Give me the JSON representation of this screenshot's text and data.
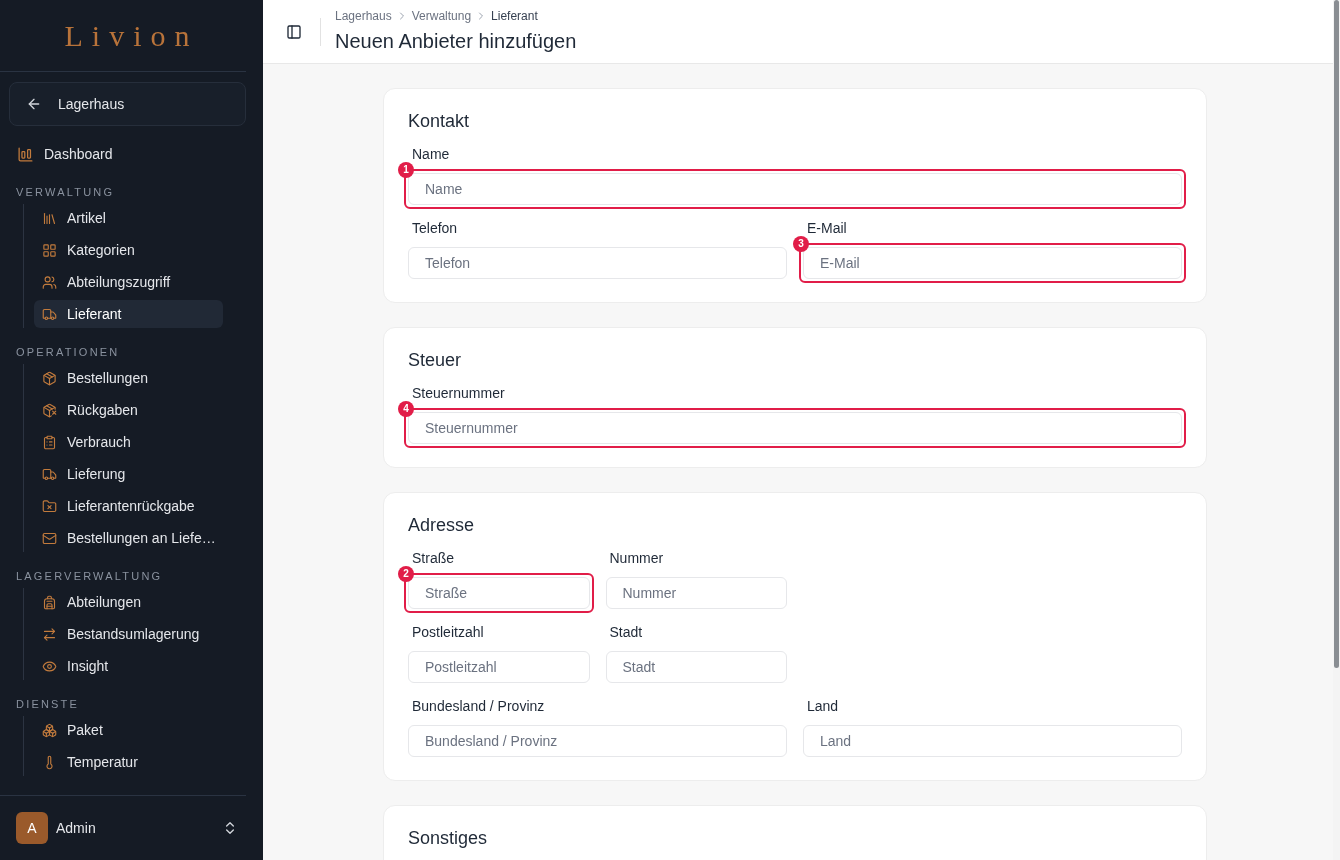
{
  "sidebar": {
    "logo": "Livion",
    "back_button": "Lagerhaus",
    "items": [
      {
        "label": "Dashboard",
        "selected": false
      }
    ],
    "sections": [
      {
        "title": "VERWALTUNG",
        "items": [
          {
            "label": "Artikel",
            "selected": false
          },
          {
            "label": "Kategorien",
            "selected": false
          },
          {
            "label": "Abteilungszugriff",
            "selected": false
          },
          {
            "label": "Lieferant",
            "selected": true
          }
        ]
      },
      {
        "title": "OPERATIONEN",
        "items": [
          {
            "label": "Bestellungen",
            "selected": false
          },
          {
            "label": "Rückgaben",
            "selected": false
          },
          {
            "label": "Verbrauch",
            "selected": false
          },
          {
            "label": "Lieferung",
            "selected": false
          },
          {
            "label": "Lieferantenrückgabe",
            "selected": false
          },
          {
            "label": "Bestellungen an Liefe…",
            "selected": false
          }
        ]
      },
      {
        "title": "LAGERVERWALTUNG",
        "items": [
          {
            "label": "Abteilungen",
            "selected": false
          },
          {
            "label": "Bestandsumlagerung",
            "selected": false
          },
          {
            "label": "Insight",
            "selected": false
          }
        ]
      },
      {
        "title": "DIENSTE",
        "items": [
          {
            "label": "Paket",
            "selected": false
          },
          {
            "label": "Temperatur",
            "selected": false
          }
        ]
      }
    ],
    "user": {
      "initial": "A",
      "name": "Admin"
    }
  },
  "header": {
    "breadcrumb": [
      {
        "label": "Lagerhaus",
        "current": false
      },
      {
        "label": "Verwaltung",
        "current": false
      },
      {
        "label": "Lieferant",
        "current": true
      }
    ],
    "title": "Neuen Anbieter hinzufügen"
  },
  "cards": [
    {
      "title": "Kontakt",
      "rows": [
        [
          {
            "label": "Name",
            "placeholder": "Name",
            "marker": "1"
          }
        ],
        [
          {
            "label": "Telefon",
            "placeholder": "Telefon"
          },
          {
            "label": "E-Mail",
            "placeholder": "E-Mail",
            "marker": "3"
          }
        ]
      ]
    },
    {
      "title": "Steuer",
      "rows": [
        [
          {
            "label": "Steuernummer",
            "placeholder": "Steuernummer",
            "marker": "4"
          }
        ]
      ]
    },
    {
      "title": "Adresse",
      "rows": [
        [
          {
            "label": "Straße",
            "placeholder": "Straße",
            "marker": "2"
          },
          {
            "label": "Nummer",
            "placeholder": "Nummer"
          }
        ],
        [
          {
            "label": "Postleitzahl",
            "placeholder": "Postleitzahl"
          },
          {
            "label": "Stadt",
            "placeholder": "Stadt"
          }
        ],
        [
          {
            "label": "Bundesland / Provinz",
            "placeholder": "Bundesland / Provinz"
          },
          {
            "label": "Land",
            "placeholder": "Land"
          }
        ]
      ]
    },
    {
      "title": "Sonstiges"
    }
  ]
}
